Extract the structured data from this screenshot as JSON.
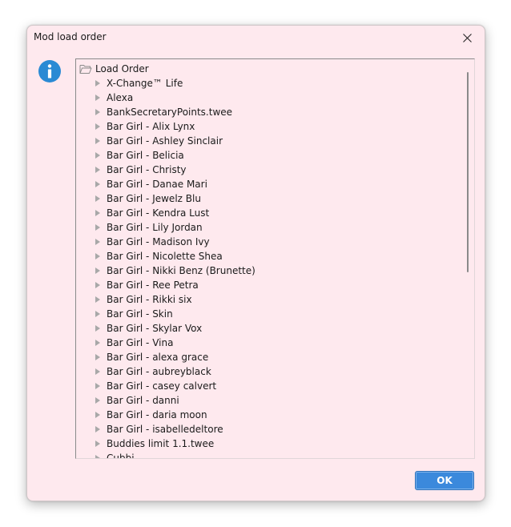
{
  "window": {
    "title": "Mod load order",
    "close_glyph": "✕"
  },
  "tree": {
    "root_label": "Load Order",
    "items": [
      "X-Change™ Life",
      "Alexa",
      "BankSecretaryPoints.twee",
      "Bar Girl - Alix Lynx",
      "Bar Girl - Ashley Sinclair",
      "Bar Girl - Belicia",
      "Bar Girl - Christy",
      "Bar Girl - Danae Mari",
      "Bar Girl - Jewelz Blu",
      "Bar Girl - Kendra Lust",
      "Bar Girl - Lily Jordan",
      "Bar Girl - Madison Ivy",
      "Bar Girl - Nicolette Shea",
      "Bar Girl - Nikki Benz (Brunette)",
      "Bar Girl - Ree Petra",
      "Bar Girl - Rikki six",
      "Bar Girl - Skin",
      "Bar Girl - Skylar Vox",
      "Bar Girl - Vina",
      "Bar Girl - alexa grace",
      "Bar Girl - aubreyblack",
      "Bar Girl - casey calvert",
      "Bar Girl - danni",
      "Bar Girl - daria moon",
      "Bar Girl - isabelledeltore",
      "Buddies limit 1.1.twee",
      "Cubbi"
    ]
  },
  "buttons": {
    "ok_label": "OK"
  },
  "icons": {
    "info": "info-icon",
    "folder": "folder-open-icon",
    "expander": "chevron-right-icon",
    "close": "close-icon"
  },
  "colors": {
    "dialog_background": "#fee9ee",
    "info_icon": "#2a8ad4",
    "ok_button": "#3b89dc"
  }
}
